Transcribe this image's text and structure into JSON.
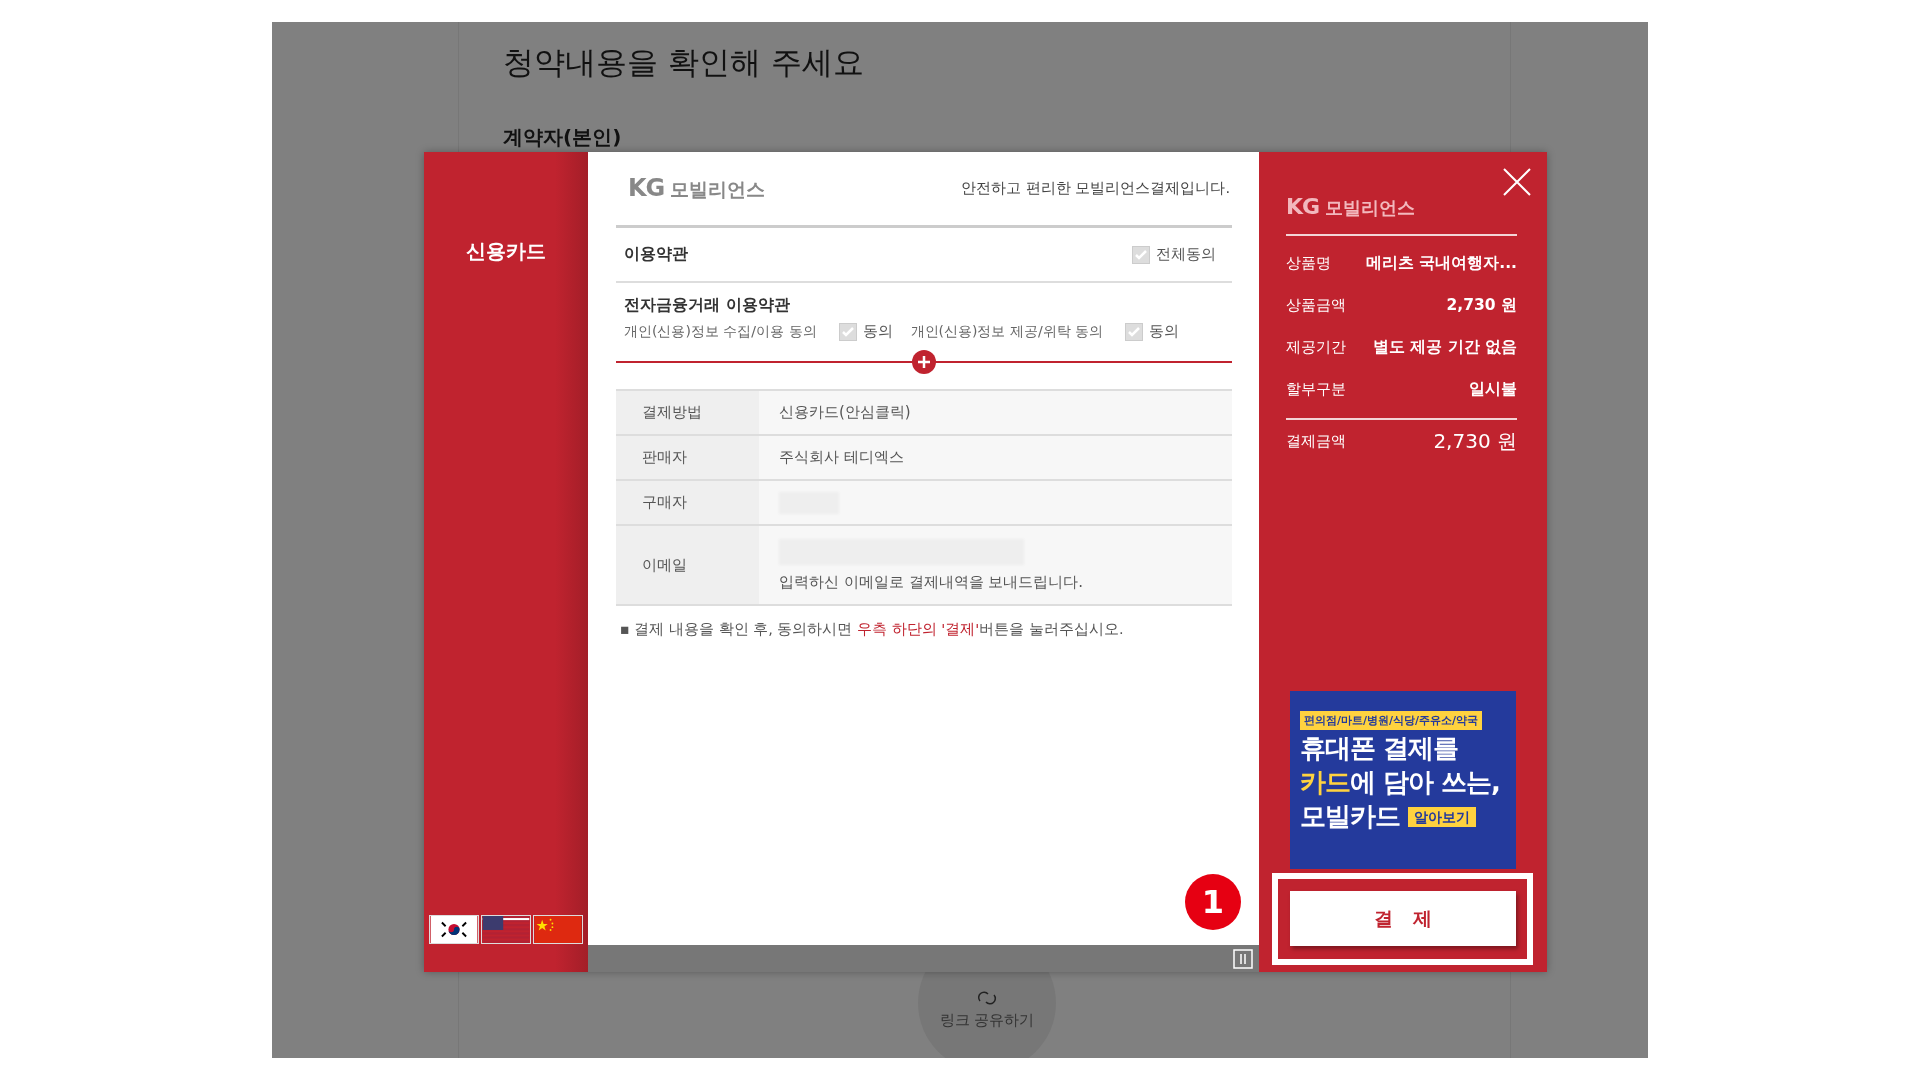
{
  "background_page": {
    "title": "청약내용을 확인해 주세요",
    "subtitle": "계약자(본인)",
    "share_label": "링크 공유하기"
  },
  "payment_window": {
    "method_tab": "신용카드",
    "languages": [
      {
        "kind": "ko"
      },
      {
        "kind": "en"
      },
      {
        "kind": "zh"
      }
    ],
    "header": {
      "logo_mark": "KG",
      "logo_text": "모빌리언스",
      "tagline": "안전하고 편리한 모빌리언스결제입니다."
    },
    "terms": {
      "title": "이용약관",
      "agree_all": {
        "label": "전체동의",
        "checked": true
      },
      "section_title": "전자금융거래 이용약관",
      "items": [
        {
          "label": "개인(신용)정보 수집/이용 동의",
          "agree_label": "동의",
          "checked": true
        },
        {
          "label": "개인(신용)정보 제공/위탁 동의",
          "agree_label": "동의",
          "checked": true
        }
      ]
    },
    "details": [
      {
        "kind": "text",
        "label": "결제방법",
        "value": "신용카드(안심클릭)"
      },
      {
        "kind": "text",
        "label": "판매자",
        "value": "주식회사 테디엑스"
      },
      {
        "kind": "masked",
        "label": "구매자"
      },
      {
        "kind": "email",
        "label": "이메일",
        "note": "입력하신 이메일로 결제내역을 보내드립니다."
      }
    ],
    "notice": {
      "bullet": "▪",
      "before": "결제 내용을 확인 후, 동의하시면 ",
      "highlight": "우측 하단의 '결제'",
      "after": "버튼을 눌러주십시오."
    },
    "summary": {
      "logo_mark": "KG",
      "logo_text": "모빌리언스",
      "rows": [
        {
          "label": "상품명",
          "value": "메리츠 국내여행자..."
        },
        {
          "label": "상품금액",
          "value": "2,730 원"
        },
        {
          "label": "제공기간",
          "value": "별도 제공 기간 없음"
        },
        {
          "label": "할부구분",
          "value": "일시불"
        }
      ],
      "total": {
        "label": "결제금액",
        "value": "2,730 원"
      }
    },
    "ad": {
      "tag": "편의점/마트/병원/식당/주유소/약국",
      "lines": [
        {
          "text": "휴대폰 결제를"
        },
        {
          "accent": "카드",
          "text": "에 담아 쓰는,"
        },
        {
          "text": "모빌카드"
        }
      ],
      "cta": "알아보기"
    },
    "pay_button": "결   제",
    "step_badge": "1"
  }
}
